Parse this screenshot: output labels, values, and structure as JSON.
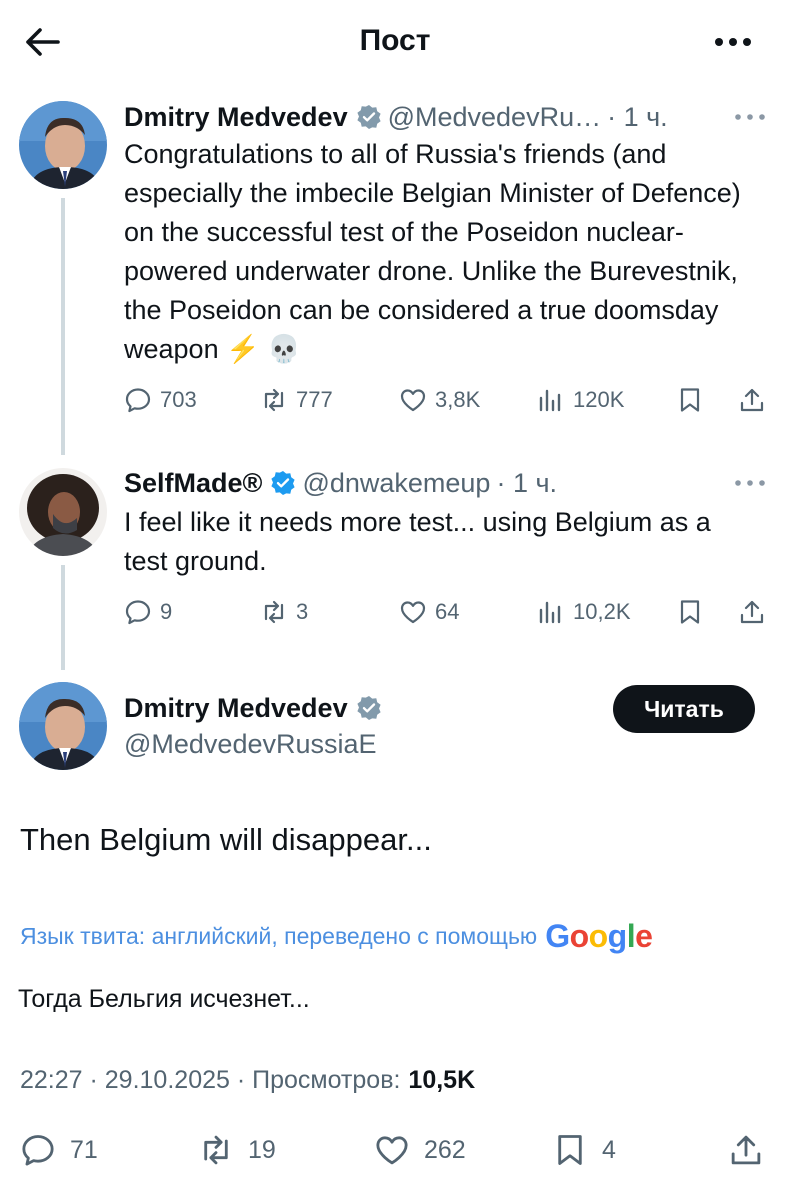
{
  "header": {
    "title": "Пост"
  },
  "thread": [
    {
      "name": "Dmitry Medvedev",
      "handle": "@MedvedevRu…",
      "time": "· 1 ч.",
      "text": "Congratulations to all of Russia's friends (and especially the imbecile Belgian Minister of Defence) on the successful test of the Poseidon nuclear-powered underwater drone. Unlike the Burevestnik, the Poseidon can be considered a true doomsday weapon ⚡ 💀",
      "replies": "703",
      "reposts": "777",
      "likes": "3,8K",
      "views": "120K"
    },
    {
      "name": "SelfMade®",
      "handle": "@dnwakemeup",
      "time": "· 1 ч.",
      "text": "I feel like it needs more test... using Belgium as a test ground.",
      "replies": "9",
      "reposts": "3",
      "likes": "64",
      "views": "10,2K"
    }
  ],
  "main": {
    "name": "Dmitry Medvedev",
    "handle": "@MedvedevRussiaE",
    "read_button": "Читать",
    "text": "Then Belgium will disappear...",
    "translate_label": "Язык твита: английский, переведено с помощью",
    "translate_brand": "Google",
    "translated_text": "Тогда Бельгия исчезнет...",
    "timestamp": "22:27 · 29.10.2025 · Просмотров:",
    "views": "10,5K",
    "replies": "71",
    "reposts": "19",
    "likes": "262",
    "bookmarks": "4"
  },
  "colors": {
    "accent": "#1d9bf0",
    "muted": "#536471",
    "link": "#4c8fe0",
    "text": "#0f1419"
  },
  "icons": [
    "back-arrow-icon",
    "more-icon",
    "verified-icon",
    "reply-icon",
    "repost-icon",
    "like-icon",
    "views-icon",
    "bookmark-icon",
    "share-icon"
  ]
}
